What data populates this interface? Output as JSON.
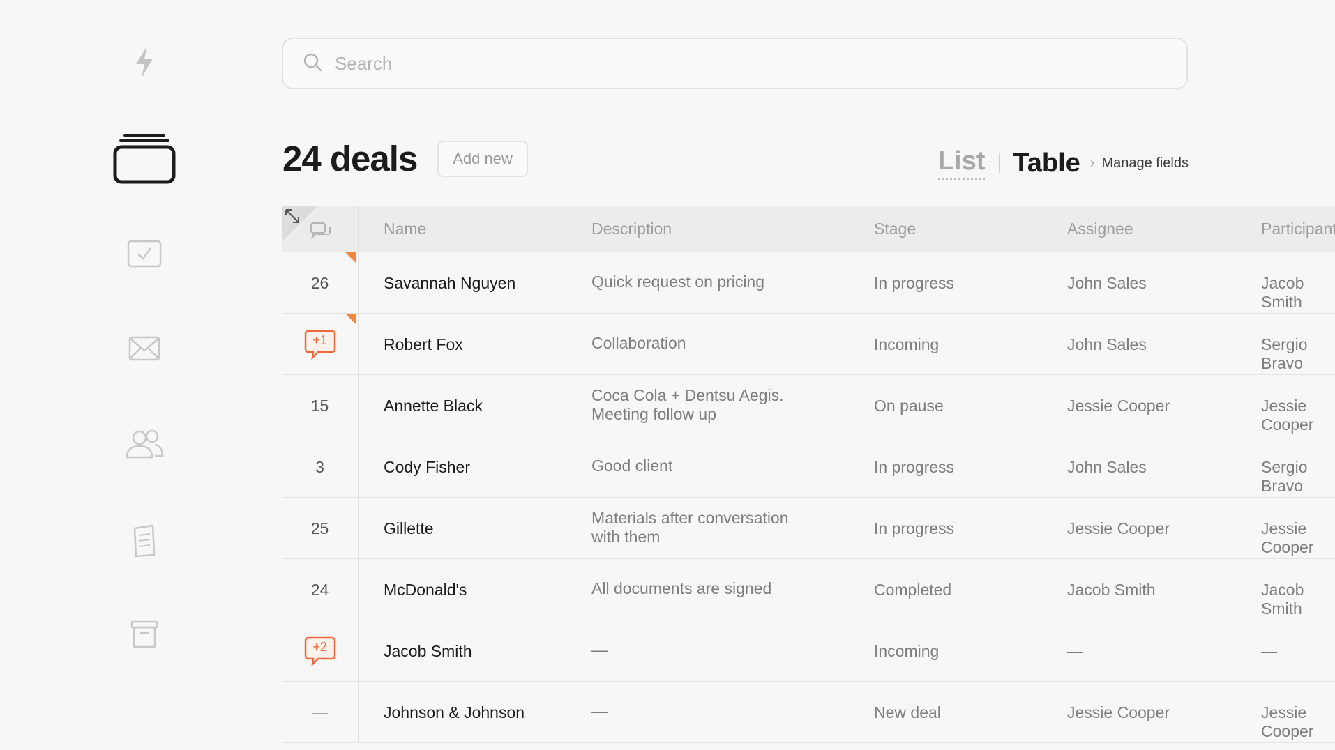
{
  "search": {
    "placeholder": "Search"
  },
  "header": {
    "title": "24 deals",
    "add_new_label": "Add new",
    "view_list": "List",
    "view_table": "Table",
    "manage_fields": "Manage fields"
  },
  "table": {
    "columns": [
      "Name",
      "Description",
      "Stage",
      "Assignee",
      "Participant"
    ],
    "rows": [
      {
        "count": "26",
        "badge": "",
        "flag": true,
        "name": "Savannah Nguyen",
        "desc1": "Quick request on pricing",
        "desc2": "",
        "stage": "In progress",
        "assignee": "John Sales",
        "participant": "Jacob Smith"
      },
      {
        "count": "",
        "badge": "+1",
        "flag": true,
        "name": "Robert Fox",
        "desc1": "Collaboration",
        "desc2": "",
        "stage": "Incoming",
        "assignee": "John Sales",
        "participant": "Sergio Bravo"
      },
      {
        "count": "15",
        "badge": "",
        "flag": false,
        "name": "Annette Black",
        "desc1": "Coca Cola + Dentsu Aegis.",
        "desc2": "Meeting follow up",
        "stage": "On pause",
        "assignee": "Jessie Cooper",
        "participant": "Jessie Cooper"
      },
      {
        "count": "3",
        "badge": "",
        "flag": false,
        "name": "Cody Fisher",
        "desc1": "Good client",
        "desc2": "",
        "stage": "In progress",
        "assignee": "John Sales",
        "participant": "Sergio Bravo"
      },
      {
        "count": "25",
        "badge": "",
        "flag": false,
        "name": "Gillette",
        "desc1": "Materials after conversation",
        "desc2": "with them",
        "stage": "In progress",
        "assignee": "Jessie Cooper",
        "participant": "Jessie Cooper"
      },
      {
        "count": "24",
        "badge": "",
        "flag": false,
        "name": "McDonald's",
        "desc1": "All documents are signed",
        "desc2": "",
        "stage": "Completed",
        "assignee": "Jacob Smith",
        "participant": "Jacob Smith"
      },
      {
        "count": "",
        "badge": "+2",
        "flag": false,
        "name": "Jacob Smith",
        "desc1": "—",
        "desc2": "",
        "stage": "Incoming",
        "assignee": "—",
        "participant": "—"
      },
      {
        "count": "—",
        "badge": "",
        "flag": false,
        "name": "Johnson & Johnson",
        "desc1": "—",
        "desc2": "",
        "stage": "New deal",
        "assignee": "Jessie Cooper",
        "participant": "Jessie Cooper"
      }
    ]
  },
  "colors": {
    "accent": "#F0873C",
    "badge": "#EF6A3A"
  },
  "icons": [
    "lightning-icon",
    "deals-stack-icon",
    "checkbox-icon",
    "mail-icon",
    "users-icon",
    "document-icon",
    "archive-icon",
    "search-icon",
    "expand-icon",
    "comments-icon",
    "comment-badge-icon"
  ]
}
